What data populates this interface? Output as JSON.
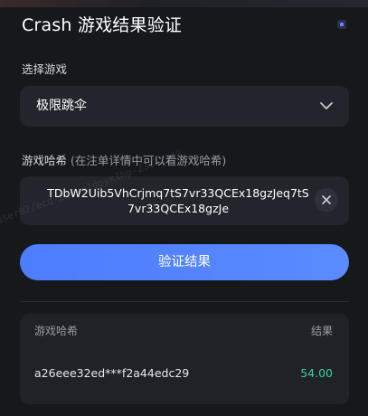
{
  "header": {
    "title": "Crash 游戏结果验证"
  },
  "game_select": {
    "label": "选择游戏",
    "selected": "极限跳伞"
  },
  "hash_field": {
    "label": "游戏哈希",
    "hint": "(在注单详情中可以看游戏哈希)",
    "value": "TDbW2Uib5VhCrjmq7tS7vr33QCEx18gzJeq7tS7vr33QCEx18gzJe"
  },
  "verify_button": {
    "label": "验证结果"
  },
  "results": {
    "col_hash": "游戏哈希",
    "col_result": "结果",
    "rows": [
      {
        "hash": "a26eee32ed***f2a44edc29",
        "result": "54.00"
      }
    ]
  },
  "watermark": {
    "text": "user02/ecd-21uxe1dpyk1hp-23111215"
  },
  "colors": {
    "background": "#17181c",
    "field": "#23252d",
    "accent": "#5a8bff",
    "result_green": "#35d39a"
  },
  "icons": [
    "chevron-down-icon",
    "clear-icon",
    "status-icon"
  ]
}
